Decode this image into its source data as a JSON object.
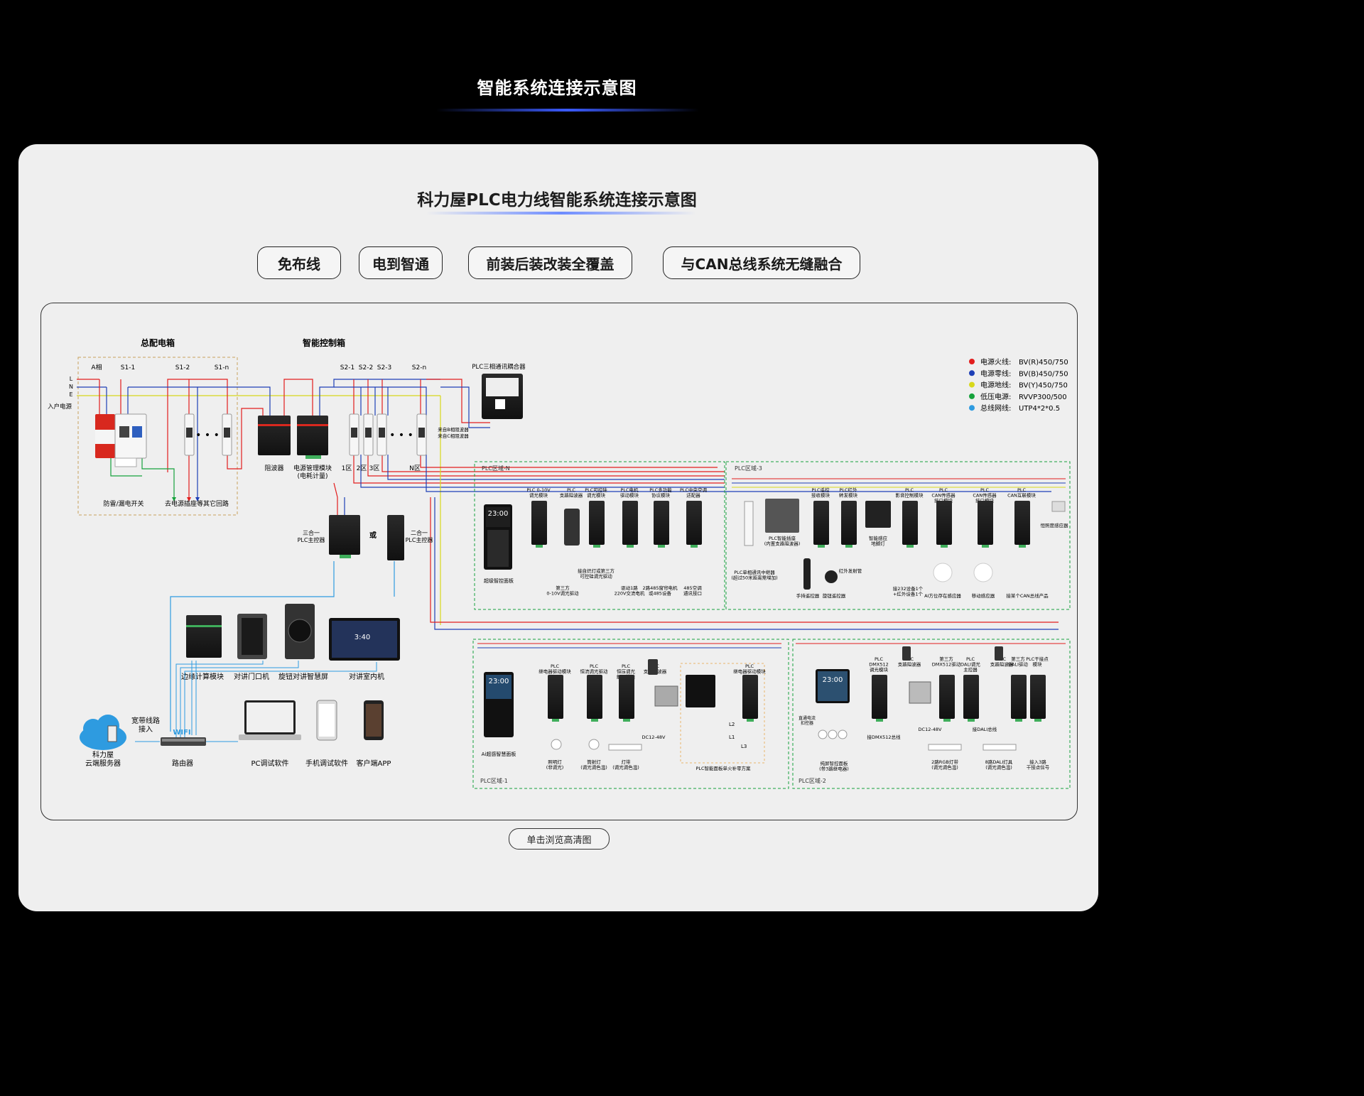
{
  "header": {
    "title": "智能系统连接示意图"
  },
  "card": {
    "title": "科力屋PLC电力线智能系统连接示意图"
  },
  "features": [
    "免布线",
    "电到智通",
    "前装后装改装全覆盖",
    "与CAN总线系统无缝融合"
  ],
  "diagram": {
    "main_box": "总配电箱",
    "control_box": "智能控制箱",
    "lne": [
      "L",
      "N",
      "E"
    ],
    "entry": "入户电源",
    "main_labels": [
      "A相",
      "S1-1",
      "S1-2",
      "S1-n"
    ],
    "control_labels": [
      "S2-1",
      "S2-2",
      "S2-3",
      "S2-n"
    ],
    "main_bottom": [
      "防雷/漏电开关",
      "去电源插座等其它回路"
    ],
    "filter": "阻波器",
    "power_mgmt": "电源管理模块",
    "power_mgmt_sub": "(电耗计量)",
    "zones": [
      "1区",
      "2区",
      "3区",
      "N区"
    ],
    "coupler": "PLC三相通讯耦合器",
    "coupler_b": "来自B相阻波器",
    "coupler_c": "来自C相阻波器",
    "ctrl3": "三合一\nPLC主控器",
    "or": "或",
    "ctrl2": "二合一\nPLC主控器",
    "legend": [
      {
        "label": "电源火线:",
        "value": "BV(R)450/750",
        "color": "#e21d1d"
      },
      {
        "label": "电源零线:",
        "value": "BV(B)450/750",
        "color": "#1d3fb6"
      },
      {
        "label": "电源地线:",
        "value": "BV(Y)450/750",
        "color": "#d8d81a"
      },
      {
        "label": "低压电源:",
        "value": "RVVP300/500",
        "color": "#16a23c"
      },
      {
        "label": "总线网线:",
        "value": "UTP4*2*0.5",
        "color": "#2e9be0"
      }
    ],
    "zoneN": {
      "title": "PLC区域-N",
      "modules": [
        "PLC 0-10V\n调光模块",
        "PLC\n支路阻波器",
        "PLC可控硅\n调光模块",
        "PLC电机\n驱动模块",
        "PLC多功能\n协议模块",
        "PLC中央空调\n适配器"
      ],
      "panel": "超级智控面板",
      "screen_time": "23:00",
      "notes": [
        "第三方\n0-10V调光驱动",
        "接自炽灯或第三方\n可控硅调光驱动",
        "驱动1路\n220V交流电机",
        "2路485窗帘电机\n或485设备",
        "485空调\n通讯接口"
      ]
    },
    "zone3": {
      "title": "PLC区域-3",
      "modules": [
        "PLC遥控\n接收模块",
        "PLC红外\n转发模块",
        "PLC\n影音控制模块",
        "PLC\nCAN传感器\n接口模块",
        "PLC\nCAN传感器\n接口模块",
        "PLC\nCAN互联模块"
      ],
      "extra": [
        "PLC智能插座\n(内置支路阻波器)",
        "智能感应\n地脚灯",
        "恒照度感应器",
        "PLC单相通讯中继器\n(超过50米距离需增加)",
        "红外发射管",
        "手持遥控器",
        "旋钮遥控器",
        "接232设备1个\n+红外设备1个",
        "AI方位存在感应器",
        "移动感应器",
        "接某个CAN总线产品"
      ]
    },
    "devices": [
      "边缘计算模块",
      "对讲门口机",
      "旋钮对讲智慧屏",
      "对讲室内机"
    ],
    "cloud": "科力屋\n云端服务器",
    "broadband": "宽带线路\n接入",
    "wifi": "WIFI",
    "router": "路由器",
    "software": [
      "PC调试软件",
      "手机调试软件",
      "客户端APP"
    ],
    "indoor_time": "3:40",
    "zone1": {
      "title": "PLC区域-1",
      "modules": [
        "PLC\n继电器驱动模块",
        "PLC\n恒流调光驱动",
        "PLC\n恒压调光\n解码模块",
        "PLC\n支路阻波器",
        "PLC\n继电器驱动模块"
      ],
      "panel": "Ai超感智慧面板",
      "screen_time": "23:00",
      "notes": [
        "照明灯\n(非调光)",
        "筒射灯\n(调光调色温)",
        "灯带\n(调光调色温)",
        "DC12-48V",
        "PLC智能面板单火补零方案"
      ],
      "lines": [
        "L2",
        "L1",
        "L3"
      ]
    },
    "zone2": {
      "title": "PLC区域-2",
      "modules": [
        "PLC\nDMX512\n调光模块",
        "PLC\n支路阻波器",
        "第三方\nDMX512驱动",
        "PLC\nDALI调光\n主控器",
        "PLC\n支路阻波器",
        "第三方\nDALI驱动",
        "PLC干接点\n模块"
      ],
      "panel": "纯屏智控面板\n(带3路继电器)",
      "panel_side": "直通电流\n扣控器",
      "screen_time": "23:00",
      "notes": [
        "接DMX512总线",
        "DC12-48V",
        "接DALI总线",
        "2路RGB灯带\n(调光调色温)",
        "8路DALI灯具\n(调光调色温)",
        "接入3路\n干接点信号"
      ]
    }
  },
  "hd_button": "单击浏览高清图"
}
